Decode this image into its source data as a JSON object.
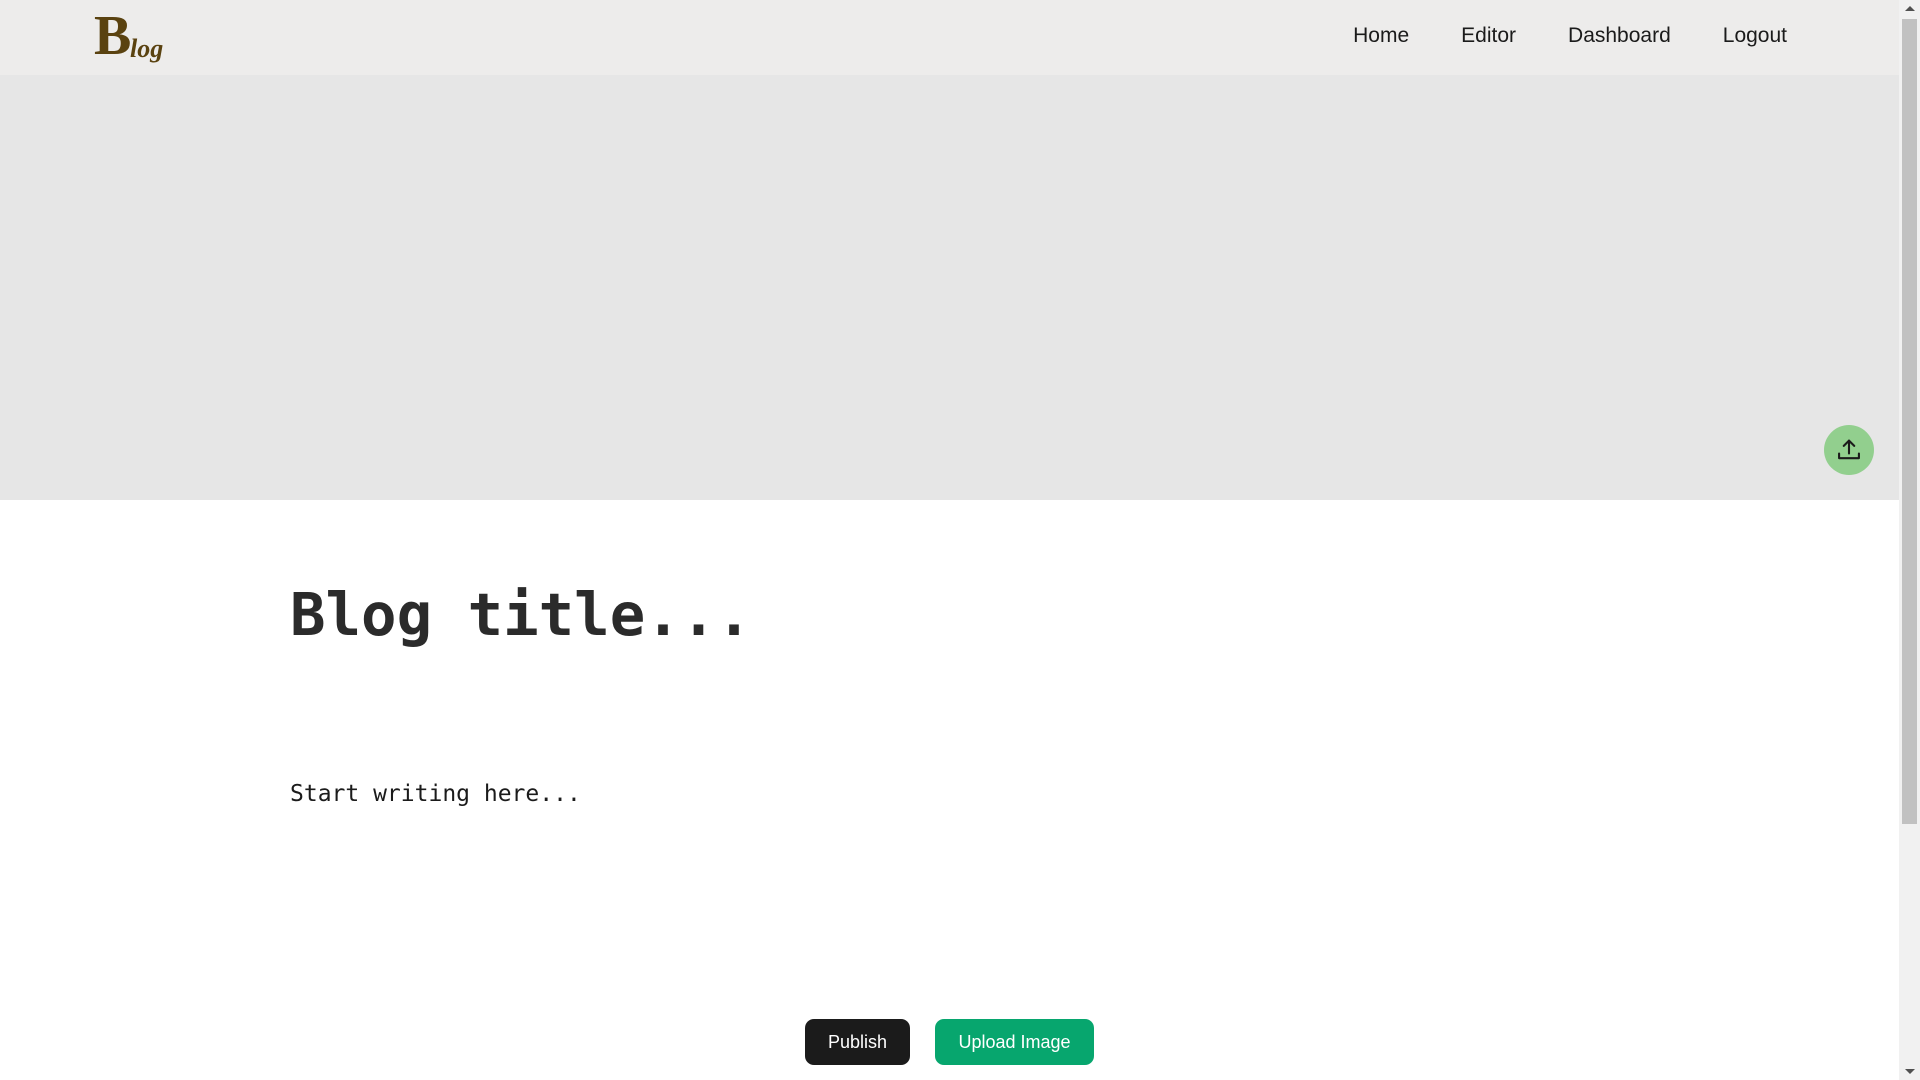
{
  "logo": {
    "initial": "B",
    "rest": "log"
  },
  "nav": {
    "items": [
      {
        "label": "Home"
      },
      {
        "label": "Editor"
      },
      {
        "label": "Dashboard"
      },
      {
        "label": "Logout"
      }
    ]
  },
  "banner": {
    "upload_icon": "upload-icon"
  },
  "editor": {
    "title_placeholder": "Blog title...",
    "title_value": "",
    "article_placeholder": "Start writing here...",
    "article_value": ""
  },
  "actions": {
    "publish_label": "Publish",
    "upload_label": "Upload Image"
  },
  "colors": {
    "navbar_bg": "#edeceb",
    "logo": "#5a4210",
    "banner_bg": "#e6e6e6",
    "upload_fab": "#92cf8e",
    "publish_btn": "#1b1b1b",
    "upload_btn": "#07a66e"
  }
}
